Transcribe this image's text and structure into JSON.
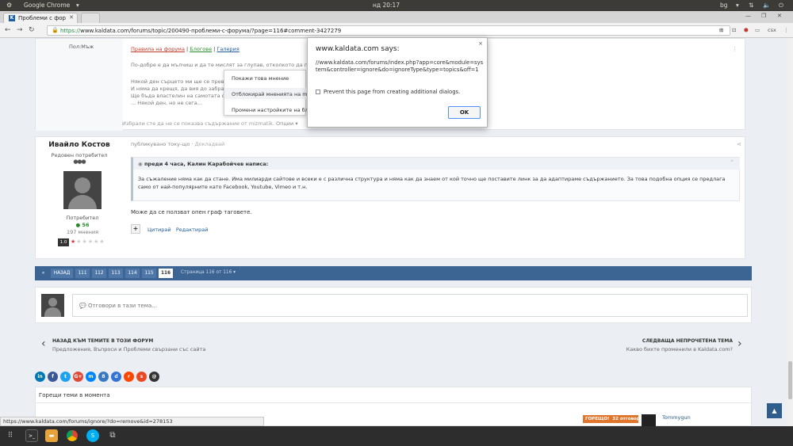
{
  "os": {
    "app_name": "Google Chrome",
    "clock": "нд 20:17",
    "lang": "bg"
  },
  "tabs": [
    {
      "label": "Проблеми с форум",
      "favicon": "K"
    }
  ],
  "address": {
    "url_https": "https://",
    "url_rest": "www.kaldata.com/forums/topic/200490-проблеми-с-форума/?page=116#comment-3427279",
    "user": "csx"
  },
  "prev_post": {
    "author_title": "Пол:Мъж",
    "signature_links": [
      "Правила на форума",
      "Блогове",
      "Галерия"
    ],
    "lines": [
      "По-добре е да мълчиш и да те мислят за глупав, отколкото да проговориш",
      "Някой ден сърцето ми ще се превърне",
      "И няма да крещя, да вия до забрава",
      "Ще бъда властелин на самотата своя",
      "... Някой ден, но не сега..."
    ],
    "hidden_note": "Избрали сте да не се показва съдържание от mizmatik.",
    "options_label": "Опции"
  },
  "context_menu": {
    "items": [
      "Покажи това мнение",
      "Отблокирай мненията на mizmatik",
      "Промени настройките на блокиране"
    ]
  },
  "dialog": {
    "title": "www.kaldata.com says:",
    "message": "//www.kaldata.com/forums/index.php?app=core&module=system&controller=ignore&do=ignoreType&type=topics&off=1",
    "checkbox": "Prevent this page from creating additional dialogs.",
    "ok": "OK",
    "close": "×"
  },
  "post": {
    "author": "Ивайло Костов",
    "rank": "Редовен потребител",
    "group": "Потребител",
    "reputation": "56",
    "posts": "197 мнения",
    "rating": "1.0",
    "stars": "★★★★★",
    "meta": "публикувано току-що",
    "meta_link": "Докладвай",
    "quote_header": "преди 4 часа, Калин Карабойчев написа:",
    "quote_text": "За съжаление няма как да стане. Има милиарди сайтове и всеки е с различна структура и няма как да знаем от кой точно ще поставите линк за да адаптираме съдържанието. За това подобна опция се предлага само от най-популярните като Facebook, Youtube, Vimeo и т.н.",
    "body": "Може да се ползват опен граф таговете.",
    "actions": [
      "Цитирай",
      "Редактирай"
    ]
  },
  "pager": {
    "back": "НАЗАД",
    "pages": [
      "111",
      "112",
      "113",
      "114",
      "115",
      "116"
    ],
    "current": "116",
    "summary": "Страница 116 от 116"
  },
  "reply": {
    "placeholder": "Отговори в тази тема..."
  },
  "nav_links": {
    "prev_title": "НАЗАД КЪМ ТЕМИТЕ В ТОЗИ ФОРУМ",
    "prev_sub": "Предложения, Въпроси и Проблеми свързани със сайта",
    "next_title": "СЛЕДВАЩА НЕПРОЧЕТЕНА ТЕМА",
    "next_sub": "Какво бихте променили в Kaldata.com?"
  },
  "share": [
    "in",
    "f",
    "t",
    "G+",
    "m",
    "8",
    "d",
    "r",
    "s",
    "@"
  ],
  "hot_topics": {
    "title": "Горещи теми в момента",
    "badge": "ГОРЕЩО!",
    "badge_count": "32 отговора",
    "user": "Tommygun"
  },
  "status_bar": "https://www.kaldata.com/forums/ignore/?do=remove&id=278153",
  "colors": {
    "accent": "#3d6594",
    "link": "#1f5c99",
    "hot": "#e0762b"
  }
}
